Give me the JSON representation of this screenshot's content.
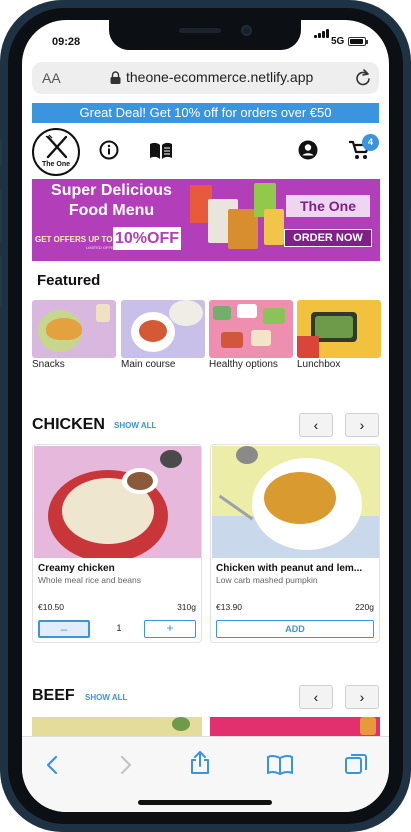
{
  "status_bar": {
    "time": "09:28",
    "network": "5G"
  },
  "browser": {
    "text_size_label": "AA",
    "url": "theone-ecommerce.netlify.app"
  },
  "promo": {
    "text": "Great Deal! Get 10% off for orders over €50"
  },
  "header": {
    "logo_text": "The One",
    "cart_count": "4"
  },
  "banner": {
    "title_line1": "Super Delicious",
    "title_line2": "Food Menu",
    "offer_text": "GET OFFERS UP TO",
    "offer_subtext": "LIMITED OFFER",
    "offer_value": "10%OFF",
    "brand": "The One",
    "cta": "ORDER NOW"
  },
  "featured": {
    "title": "Featured",
    "categories": [
      {
        "label": "Snacks"
      },
      {
        "label": "Main course"
      },
      {
        "label": "Healthy options"
      },
      {
        "label": "Lunchbox"
      }
    ]
  },
  "sections": [
    {
      "title": "CHICKEN",
      "show_all": "SHOW ALL",
      "prev": "‹",
      "next": "›",
      "products": [
        {
          "name": "Creamy chicken",
          "description": "Whole meal rice and beans",
          "price": "€10.50",
          "weight": "310g",
          "quantity": "1",
          "minus": "–",
          "plus": "+"
        },
        {
          "name": "Chicken with peanut and lem...",
          "description": "Low carb mashed pumpkin",
          "price": "€13.90",
          "weight": "220g",
          "add_label": "ADD"
        }
      ]
    },
    {
      "title": "BEEF",
      "show_all": "SHOW ALL",
      "prev": "‹",
      "next": "›"
    }
  ],
  "colors": {
    "accent": "#3b94de",
    "banner": "#b23fb9",
    "banner_dark": "#7f1f8a"
  }
}
